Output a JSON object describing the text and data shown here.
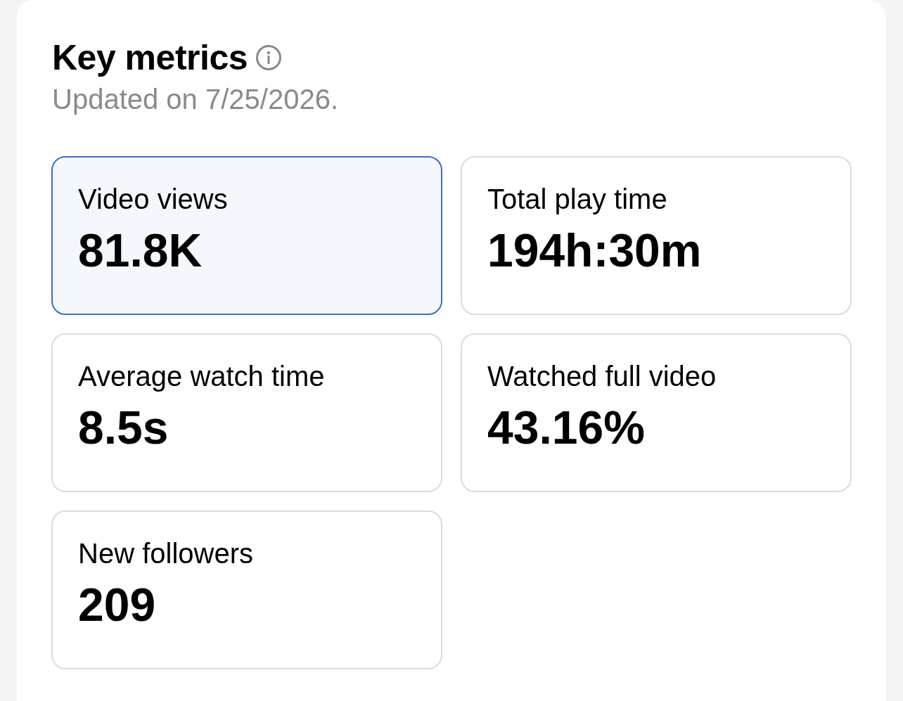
{
  "header": {
    "title": "Key metrics",
    "subtitle": "Updated on 7/25/2026."
  },
  "metrics": [
    {
      "label": "Video views",
      "value": "81.8K",
      "selected": true
    },
    {
      "label": "Total play time",
      "value": "194h:30m",
      "selected": false
    },
    {
      "label": "Average watch time",
      "value": "8.5s",
      "selected": false
    },
    {
      "label": "Watched full video",
      "value": "43.16%",
      "selected": false
    },
    {
      "label": "New followers",
      "value": "209",
      "selected": false
    }
  ]
}
